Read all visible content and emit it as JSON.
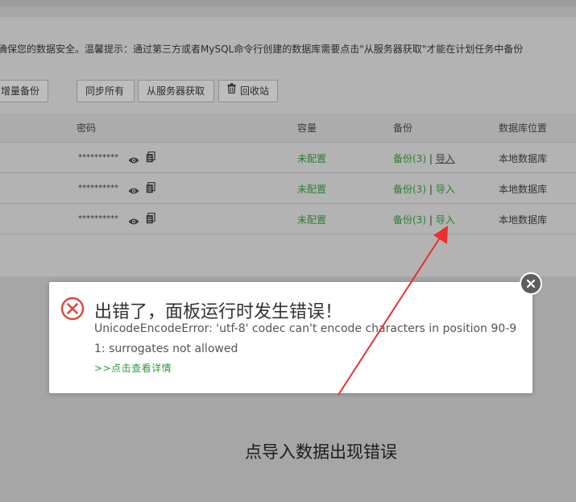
{
  "notice": "确保您的数据安全。温馨提示：通过第三方或者MySQL命令行创建的数据库需要点击\"从服务器获取\"才能在计划任务中备份",
  "toolbar": {
    "incremental_backup": "增量备份",
    "sync_all": "同步所有",
    "fetch_from_server": "从服务器获取",
    "recycle_bin": "回收站"
  },
  "table": {
    "headers": {
      "password": "密码",
      "capacity": "容量",
      "backup": "备份",
      "location": "数据库位置"
    },
    "rows": [
      {
        "password": "**********",
        "capacity": "未配置",
        "backup": "备份(3)",
        "separator": "|",
        "import": "导入",
        "location": "本地数据库"
      },
      {
        "password": "**********",
        "capacity": "未配置",
        "backup": "备份(3)",
        "separator": "|",
        "import": "导入",
        "location": "本地数据库"
      },
      {
        "password": "**********",
        "capacity": "未配置",
        "backup": "备份(3)",
        "separator": "|",
        "import": "导入",
        "location": "本地数据库"
      }
    ]
  },
  "dialog": {
    "title": "出错了，面板运行时发生错误！",
    "message": "UnicodeEncodeError: 'utf-8' codec can't encode characters in position 90-91: surrogates not allowed",
    "details_link": ">>点击查看详情"
  },
  "annotation": {
    "caption": "点导入数据出现错误",
    "arrow_color": "#e8312f"
  },
  "colors": {
    "error_red": "#e0453b",
    "link_green": "#2e9a3c",
    "status_green": "#2c7d34"
  }
}
